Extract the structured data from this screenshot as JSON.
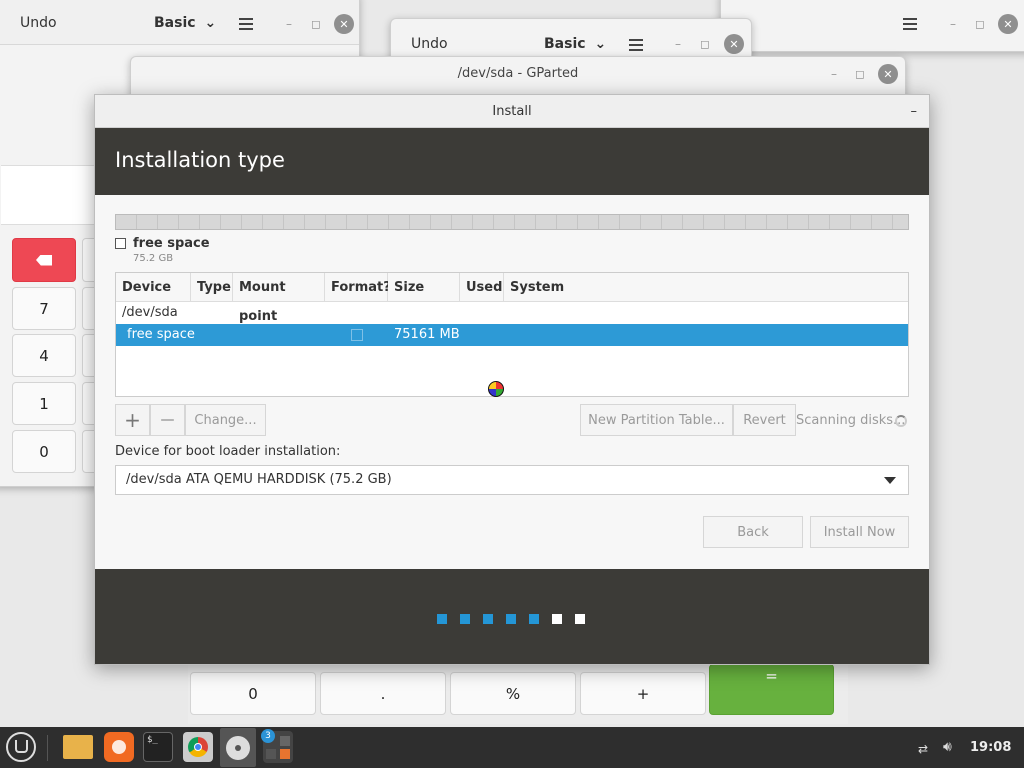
{
  "back_window_left": {
    "undo_label": "Undo",
    "mode_label": "Basic",
    "keys": [
      {
        "id": "backspace",
        "label": ""
      },
      {
        "id": "7",
        "label": "7"
      },
      {
        "id": "4",
        "label": "4"
      },
      {
        "id": "1",
        "label": "1"
      },
      {
        "id": "0",
        "label": "0"
      }
    ]
  },
  "back_window_mid": {
    "undo_label": "Undo",
    "mode_label": "Basic"
  },
  "gparted": {
    "title": "/dev/sda - GParted"
  },
  "calc_bottom_keys": [
    {
      "id": "zero",
      "label": "0"
    },
    {
      "id": "dot",
      "label": "."
    },
    {
      "id": "percent",
      "label": "%"
    },
    {
      "id": "plus",
      "label": "+"
    },
    {
      "id": "equals",
      "label": "="
    }
  ],
  "install": {
    "window_title": "Install",
    "minimize_label": "–",
    "heading": "Installation type",
    "legend": {
      "label": "free space",
      "size": "75.2 GB"
    },
    "table": {
      "headers": [
        "Device",
        "Type",
        "Mount point",
        "Format?",
        "Size",
        "Used",
        "System"
      ],
      "rows": [
        {
          "device": "/dev/sda",
          "size": ""
        },
        {
          "device": "free space",
          "size": "75161 MB"
        }
      ]
    },
    "buttons": {
      "add": "+",
      "remove": "—",
      "change": "Change...",
      "new_table": "New Partition Table...",
      "revert": "Revert",
      "back": "Back",
      "install_now": "Install Now"
    },
    "scanning_text": "Scanning disks...",
    "boot_label": "Device for boot loader installation:",
    "boot_value": "/dev/sda ATA QEMU HARDDISK (75.2 GB)",
    "progress": {
      "total": 7,
      "active": 5,
      "active_color": "#2496d6",
      "inactive_color": "#ffffff"
    }
  },
  "taskbar": {
    "clock": "19:08",
    "calc_badge": "3"
  },
  "colors": {
    "banner": "#3c3b37",
    "selection": "#2d9ad6",
    "delete_key": "#ee4854",
    "equals_key": "#67b13e"
  }
}
